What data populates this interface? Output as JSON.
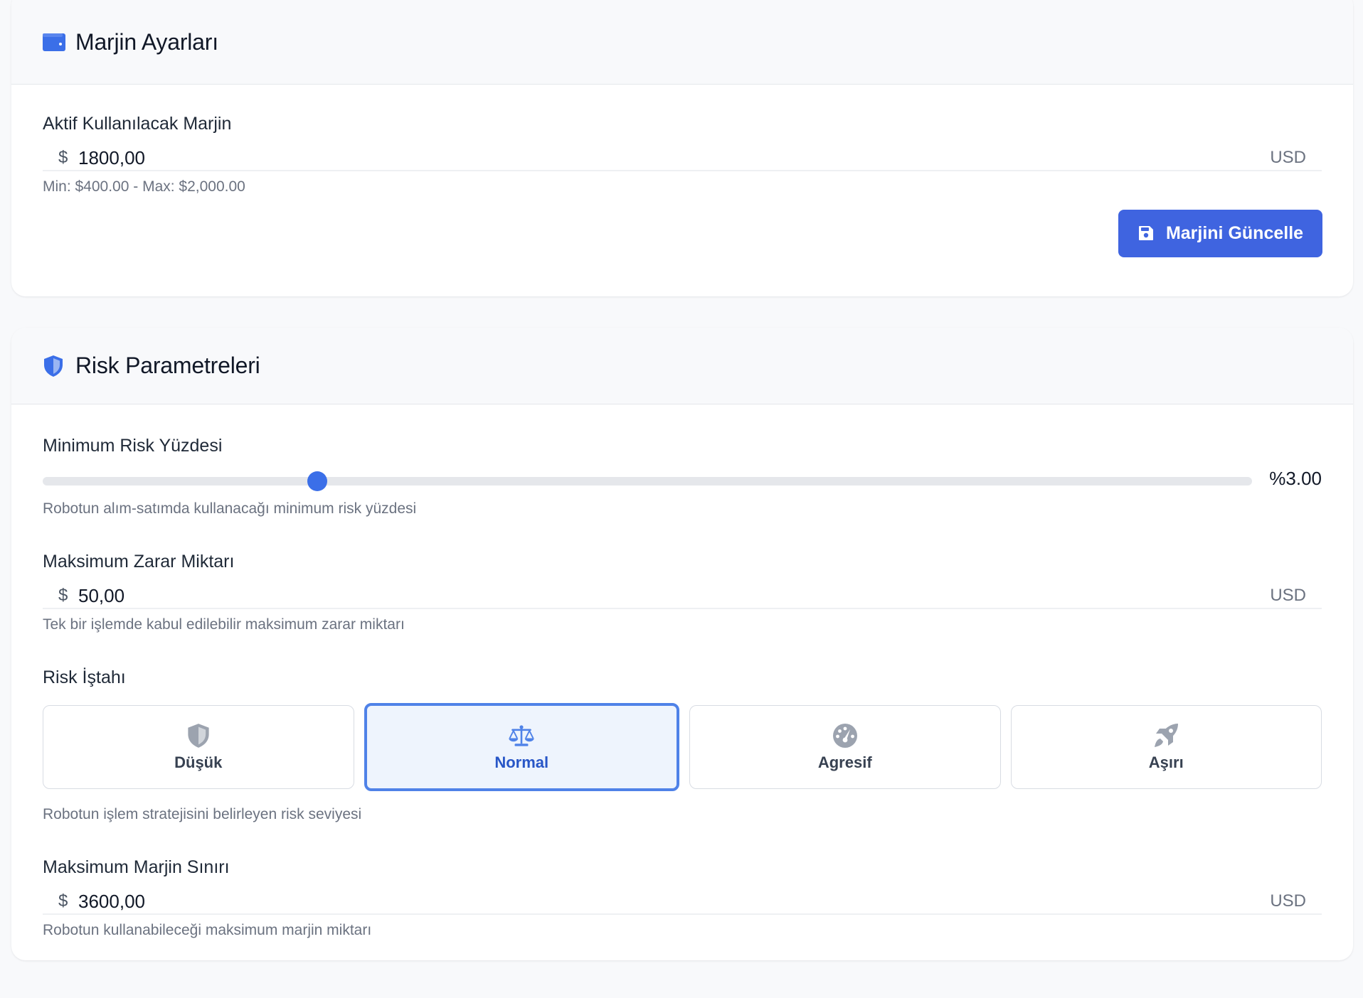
{
  "margin_settings": {
    "title": "Marjin Ayarları",
    "icon": "wallet-icon",
    "active_margin": {
      "label": "Aktif Kullanılacak Marjin",
      "prefix": "$",
      "value": "1800,00",
      "suffix": "USD",
      "help": "Min: $400.00 - Max: $2,000.00"
    },
    "update_button": {
      "label": "Marjini Güncelle",
      "icon": "save-icon"
    }
  },
  "risk_parameters": {
    "title": "Risk Parametreleri",
    "icon": "shield-icon",
    "min_risk": {
      "label": "Minimum Risk Yüzdesi",
      "value_text": "%3.00",
      "slider_fraction": 0.227,
      "help": "Robotun alım-satımda kullanacağı minimum risk yüzdesi"
    },
    "max_loss": {
      "label": "Maksimum Zarar Miktarı",
      "prefix": "$",
      "value": "50,00",
      "suffix": "USD",
      "help": "Tek bir işlemde kabul edilebilir maksimum zarar miktarı"
    },
    "risk_appetite": {
      "label": "Risk İştahı",
      "options": [
        {
          "label": "Düşük",
          "icon": "shield-icon",
          "selected": false
        },
        {
          "label": "Normal",
          "icon": "balance-scale-icon",
          "selected": true
        },
        {
          "label": "Agresif",
          "icon": "gauge-icon",
          "selected": false
        },
        {
          "label": "Aşırı",
          "icon": "rocket-icon",
          "selected": false
        }
      ],
      "help": "Robotun işlem stratejisini belirleyen risk seviyesi"
    },
    "max_margin_limit": {
      "label": "Maksimum Marjin Sınırı",
      "prefix": "$",
      "value": "3600,00",
      "suffix": "USD",
      "help": "Robotun kullanabileceği maksimum marjin miktarı"
    }
  },
  "colors": {
    "primary": "#3f64e0",
    "selected_border": "#4f82e8",
    "selected_bg": "#eef4fd",
    "icon_muted": "#9ca3af"
  }
}
